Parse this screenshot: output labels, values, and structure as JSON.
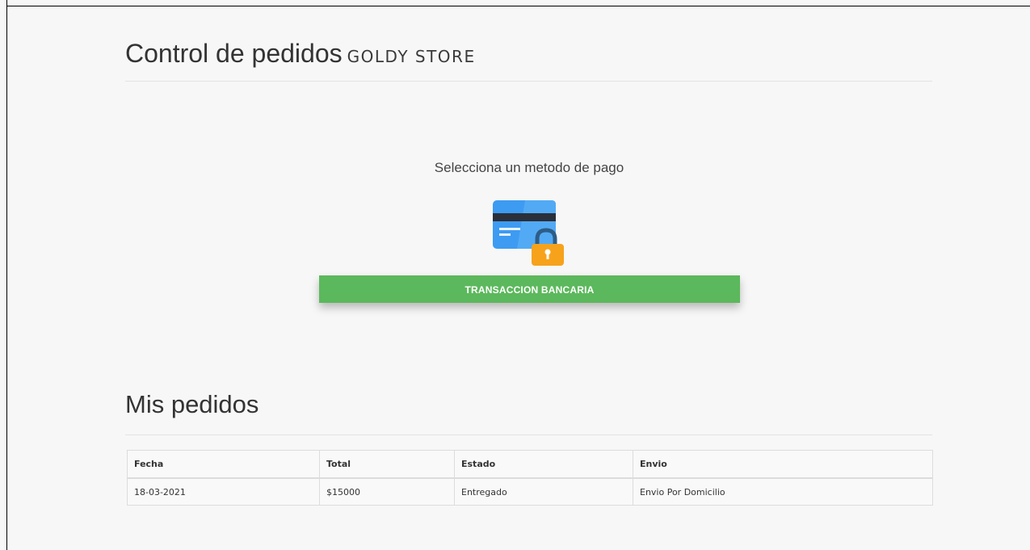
{
  "header": {
    "title": "Control de pedidos",
    "brand": "Goldy Store"
  },
  "payment": {
    "prompt": "Selecciona un metodo de pago",
    "icon": "credit-card-lock-icon",
    "button_label": "TRANSACCION BANCARIA",
    "button_color": "#5cb85c"
  },
  "orders": {
    "title": "Mis pedidos",
    "columns": [
      "Fecha",
      "Total",
      "Estado",
      "Envio"
    ],
    "rows": [
      [
        "18-03-2021",
        "$15000",
        "Entregado",
        "Envio Por Domicilio"
      ]
    ]
  }
}
